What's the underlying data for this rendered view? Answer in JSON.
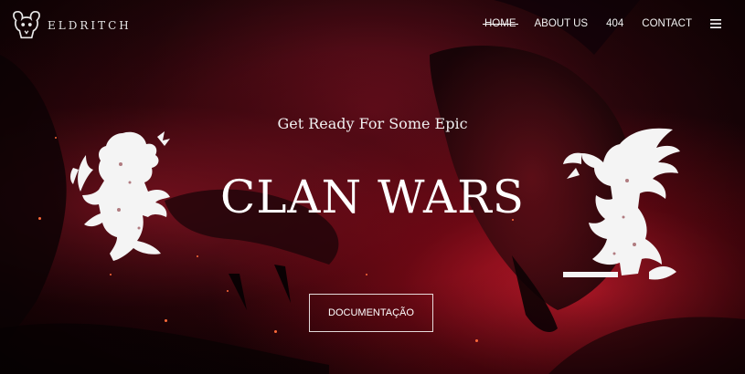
{
  "brand": {
    "name": "ELDRITCH",
    "logo_icon": "ram-skull-icon"
  },
  "nav": {
    "items": [
      {
        "label": "HOME",
        "active": true
      },
      {
        "label": "ABOUT US",
        "active": false
      },
      {
        "label": "404",
        "active": false
      },
      {
        "label": "CONTACT",
        "active": false
      }
    ],
    "menu_icon": "hamburger-menu-icon"
  },
  "hero": {
    "tagline": "Get Ready For Some Epic",
    "title": "CLAN WARS",
    "cta_label": "DOCUMENTAÇÃO",
    "left_crest_icon": "rampant-lion-crest-icon",
    "right_crest_icon": "griffin-crest-icon"
  },
  "colors": {
    "accent": "#c4142a",
    "text": "#ffffff",
    "background": "#2a070c"
  }
}
